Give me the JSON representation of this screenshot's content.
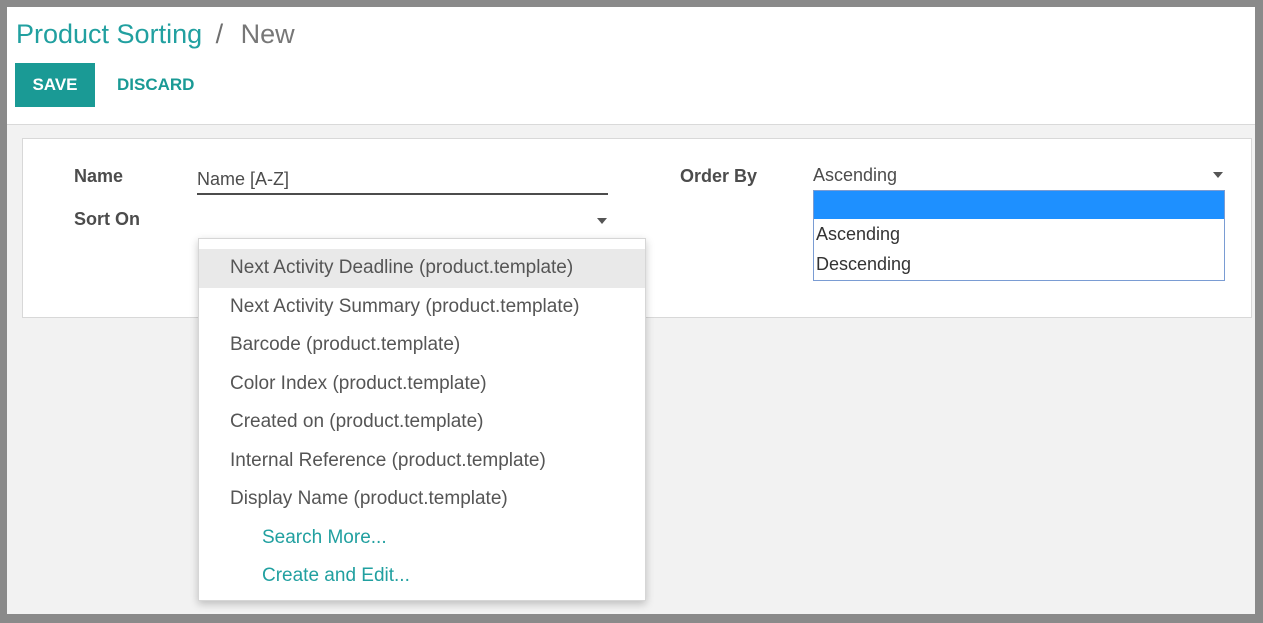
{
  "breadcrumb": {
    "parent": "Product Sorting",
    "separator": "/",
    "current": "New"
  },
  "buttons": {
    "save": "SAVE",
    "discard": "DISCARD"
  },
  "form": {
    "name_label": "Name",
    "name_value": "Name [A-Z]",
    "sort_on_label": "Sort On",
    "sort_on_value": "",
    "order_by_label": "Order By",
    "order_by_value": "Ascending"
  },
  "order_by_dropdown": {
    "options": [
      "",
      "Ascending",
      "Descending"
    ],
    "highlighted_index": 0
  },
  "sort_on_autocomplete": {
    "items": [
      "Next Activity Deadline (product.template)",
      "Next Activity Summary (product.template)",
      "Barcode (product.template)",
      "Color Index (product.template)",
      "Created on (product.template)",
      "Internal Reference (product.template)",
      "Display Name (product.template)"
    ],
    "highlighted_index": 0,
    "search_more": "Search More...",
    "create_and_edit": "Create and Edit..."
  },
  "colors": {
    "brand_teal": "#1a9a95",
    "link_teal": "#21a0a0",
    "selection_blue": "#1e90ff",
    "text": "#4c4c4c"
  },
  "icons": {
    "dropdown_caret": "caret-down-icon"
  }
}
